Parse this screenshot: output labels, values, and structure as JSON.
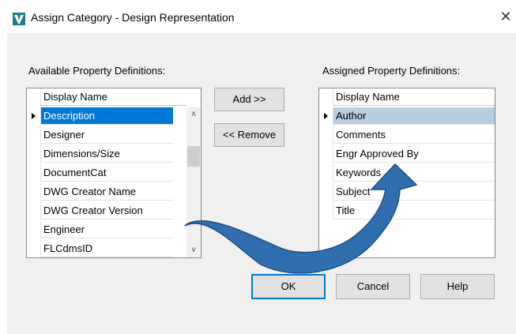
{
  "window": {
    "title": "Assign Category - Design Representation",
    "close_glyph": "✕"
  },
  "left": {
    "label": "Available Property Definitions:",
    "header": "Display Name",
    "selected_index": 0,
    "items": [
      "Description",
      "Designer",
      "Dimensions/Size",
      "DocumentCat",
      "DWG Creator Name",
      "DWG Creator Version",
      "Engineer",
      "FLCdmsID"
    ]
  },
  "right": {
    "label": "Assigned Property Definitions:",
    "header": "Display Name",
    "selected_index": 0,
    "items": [
      "Author",
      "Comments",
      "Engr Approved By",
      "Keywords",
      "Subject",
      "Title"
    ]
  },
  "buttons": {
    "add": "Add >>",
    "remove": "<< Remove",
    "ok": "OK",
    "cancel": "Cancel",
    "help": "Help"
  },
  "scroll": {
    "up": "∧",
    "down": "∨"
  },
  "colors": {
    "selection_active": "#0078d7",
    "selection_inactive": "#b9cde0",
    "arrow": "#2f6fb0"
  },
  "icons": {
    "app": "autodesk-v-icon",
    "arrow": "curved-arrow-icon"
  }
}
